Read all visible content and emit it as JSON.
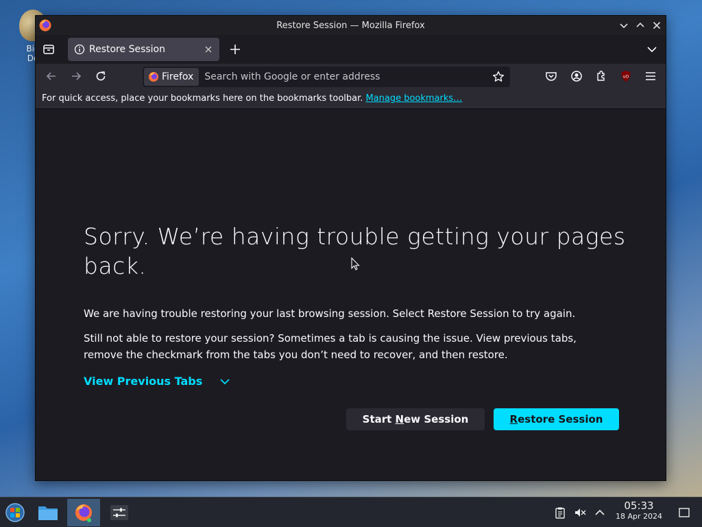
{
  "desktop": {
    "icon_label": "Big\nDe"
  },
  "window": {
    "title": "Restore Session — Mozilla Firefox"
  },
  "tabs": [
    {
      "title": "Restore Session",
      "active": true
    }
  ],
  "navbar": {
    "identity_label": "Firefox",
    "url_placeholder": "Search with Google or enter address"
  },
  "bookmarks_bar": {
    "message": "For quick access, place your bookmarks here on the bookmarks toolbar.",
    "link_label": "Manage bookmarks…"
  },
  "page": {
    "headline": "Sorry. We’re having trouble getting your pages back.",
    "paragraph1": "We are having trouble restoring your last browsing session. Select Restore Session to try again.",
    "paragraph2": "Still not able to restore your session? Sometimes a tab is causing the issue. View previous tabs, remove the checkmark from the tabs you don’t need to recover, and then restore.",
    "view_previous_tabs": "View Previous Tabs",
    "start_new_session_pre": "Start ",
    "start_new_session_key": "N",
    "start_new_session_post": "ew Session",
    "restore_session_key": "R",
    "restore_session_post": "estore Session"
  },
  "taskbar": {
    "time": "05:33",
    "date": "18 Apr 2024"
  },
  "colors": {
    "accent": "#00ddff",
    "window_bg": "#1c1b22",
    "toolbar_bg": "#2b2a33"
  },
  "icons": {
    "window_controls": [
      "minimize-icon",
      "maximize-icon",
      "close-icon"
    ],
    "toolbar": [
      "pocket-icon",
      "account-icon",
      "extensions-icon",
      "ublock-icon",
      "menu-icon"
    ]
  }
}
